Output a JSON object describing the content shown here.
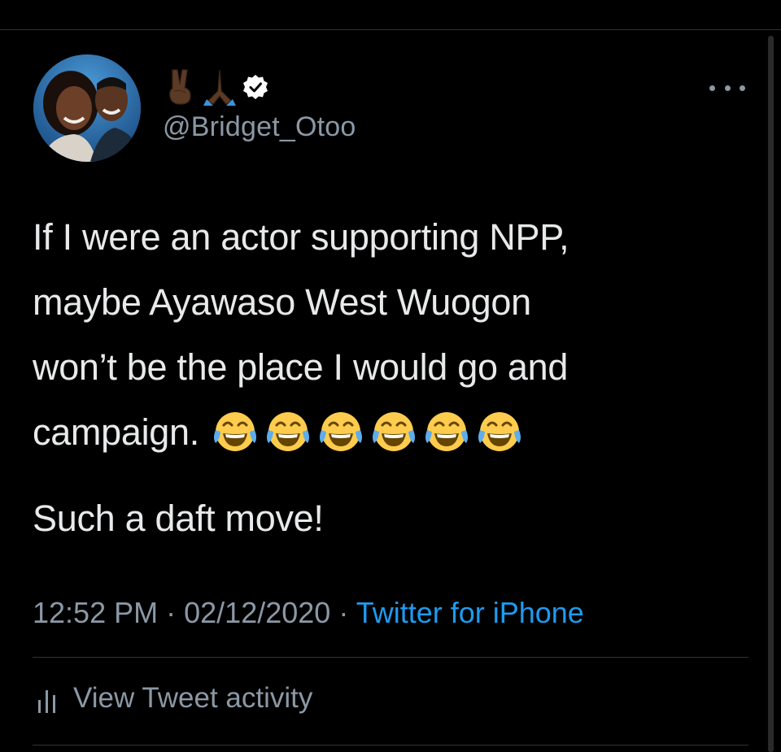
{
  "author": {
    "display_name_emojis": [
      "victory-hand-emoji",
      "folded-hands-emoji"
    ],
    "verified": true,
    "handle": "@Bridget_Otoo",
    "avatar": "profile-photo"
  },
  "tweet": {
    "lines": [
      "If I were an actor supporting NPP,",
      "maybe Ayawaso West Wuogon",
      "won’t be the place I would go and",
      "campaign."
    ],
    "laughing_emoji_count": 6,
    "second_paragraph": "Such a daft move!"
  },
  "meta": {
    "time": "12:52 PM",
    "separator": "·",
    "date": "02/12/2020",
    "source": "Twitter for iPhone"
  },
  "actions": {
    "view_activity": "View Tweet activity"
  },
  "colors": {
    "background": "#000000",
    "text": "#e7e9ea",
    "muted": "#8b98a5",
    "link": "#1d9bf0",
    "divider": "#2f3336",
    "verified_badge": "#ffffff"
  },
  "icons": [
    "more-icon",
    "verified-badge-icon",
    "activity-chart-icon",
    "face-with-tears-of-joy-emoji"
  ]
}
